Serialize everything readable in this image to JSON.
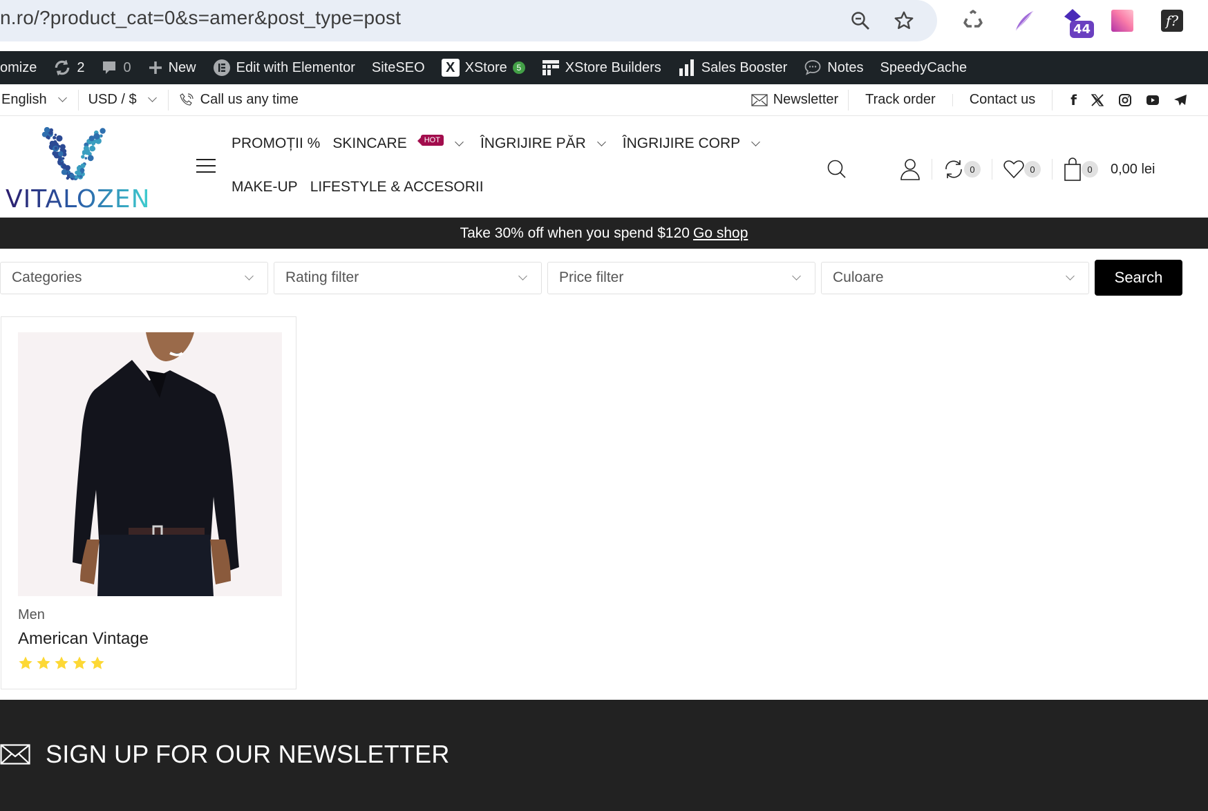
{
  "browser": {
    "url": "n.ro/?product_cat=0&s=amer&post_type=post",
    "extensions": [
      "recycle-extension",
      "quill-extension",
      "stack-extension",
      "gradient-extension",
      "font-finder-extension"
    ],
    "extension_badge": "44"
  },
  "admin_bar": {
    "customize_label": "omize",
    "updates_count": "2",
    "comments_count": "0",
    "new_label": "New",
    "elementor_label": "Edit with Elementor",
    "siteseo_label": "SiteSEO",
    "xstore_label": "XStore",
    "xstore_badge": "5",
    "builders_label": "XStore Builders",
    "sales_booster_label": "Sales Booster",
    "notes_label": "Notes",
    "speedycache_label": "SpeedyCache"
  },
  "topbar": {
    "language": "English",
    "currency": "USD / $",
    "call_label": "Call us any time",
    "newsletter_label": "Newsletter",
    "track_order_label": "Track order",
    "contact_label": "Contact us",
    "social": [
      "facebook",
      "x",
      "instagram",
      "youtube",
      "telegram"
    ]
  },
  "header": {
    "logo_text": "VITALOZEN",
    "menu_row1": [
      {
        "label": "PROMOȚII %",
        "dropdown": false
      },
      {
        "label": "SKINCARE",
        "dropdown": true,
        "badge": "HOT"
      },
      {
        "label": "ÎNGRIJIRE PĂR",
        "dropdown": true
      },
      {
        "label": "ÎNGRIJIRE CORP",
        "dropdown": true
      }
    ],
    "menu_row2": [
      {
        "label": "MAKE-UP"
      },
      {
        "label": "LIFESTYLE & ACCESORII"
      }
    ],
    "compare_count": "0",
    "wishlist_count": "0",
    "cart_count": "0",
    "cart_total": "0,00 lei"
  },
  "promo": {
    "text": "Take 30% off when you spend $120",
    "link_label": "Go shop"
  },
  "filters": {
    "categories": "Categories",
    "rating": "Rating filter",
    "price": "Price filter",
    "color": "Culoare",
    "search_label": "Search"
  },
  "products": [
    {
      "category": "Men",
      "title": "American Vintage",
      "rating": 5,
      "rating_max": 5
    }
  ],
  "newsletter": {
    "title": "SIGN UP FOR OUR NEWSLETTER"
  },
  "colors": {
    "hot_badge": "#a20d4d",
    "star": "#fdd835",
    "dark_bar": "#222222",
    "admin_bar": "#1d2327"
  }
}
